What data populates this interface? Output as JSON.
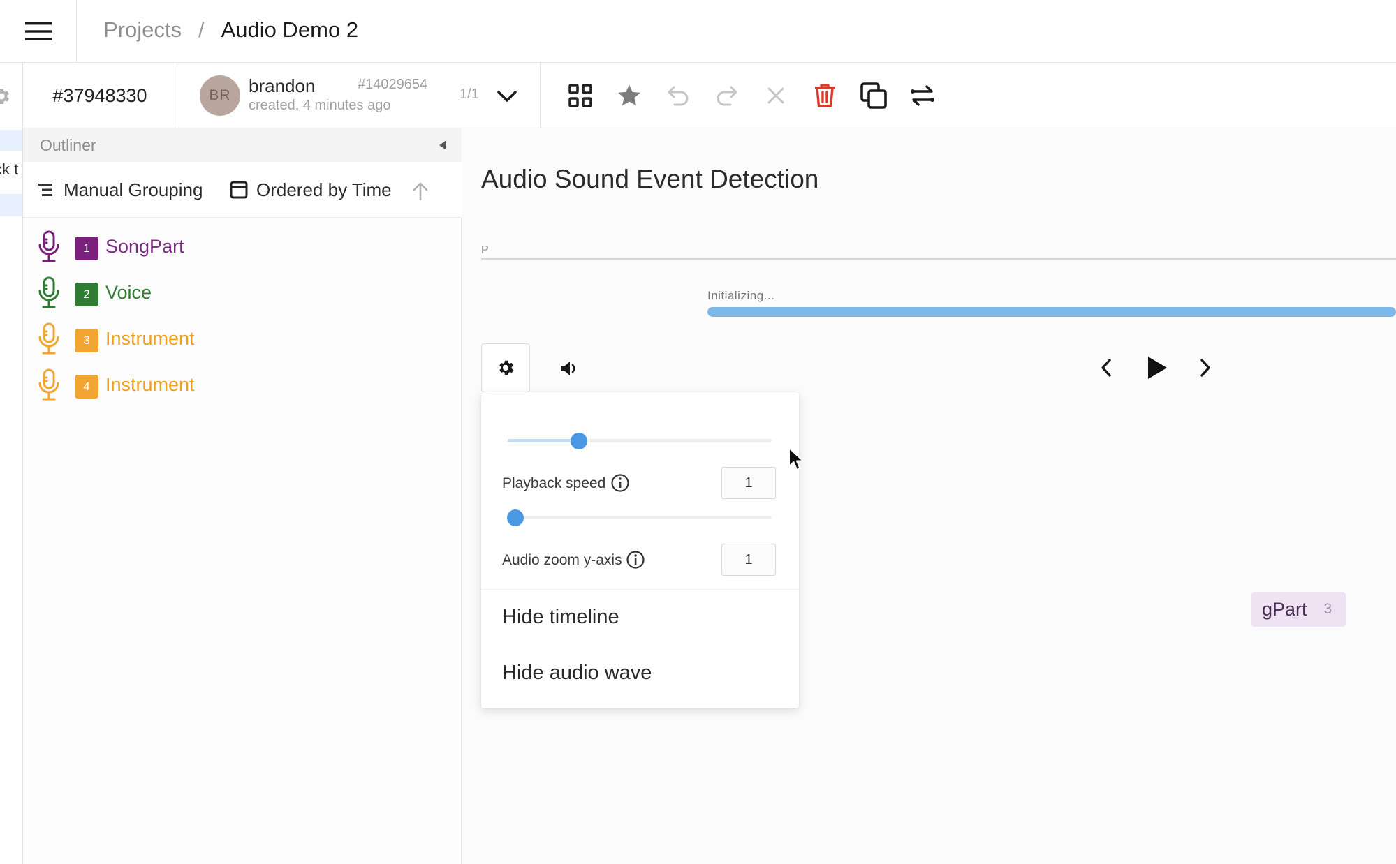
{
  "header": {
    "menu_icon": "hamburger-menu-icon",
    "breadcrumb": {
      "projects": "Projects",
      "separator": "/",
      "current": "Audio Demo 2"
    }
  },
  "toolbar": {
    "task_id": "#37948330",
    "annotation": {
      "avatar_initials": "BR",
      "user": "brandon",
      "created": "created, 4 minutes ago",
      "id": "#14029654",
      "count": "1/1"
    },
    "tools": [
      {
        "name": "grid-view-icon"
      },
      {
        "name": "star-icon"
      },
      {
        "name": "undo-icon"
      },
      {
        "name": "redo-icon"
      },
      {
        "name": "close-icon"
      },
      {
        "name": "trash-icon",
        "color": "#d93a2b"
      },
      {
        "name": "duplicate-icon"
      },
      {
        "name": "swap-icon"
      }
    ]
  },
  "left_rail": {
    "partial_text": "ck t"
  },
  "outliner": {
    "title": "Outliner",
    "grouping": "Manual Grouping",
    "ordering": "Ordered by Time",
    "regions": [
      {
        "index": "1",
        "label": "SongPart",
        "color": "#7b1f7c",
        "text_color": "#7b2c80"
      },
      {
        "index": "2",
        "label": "Voice",
        "color": "#2f7d32",
        "text_color": "#2f7d32"
      },
      {
        "index": "3",
        "label": "Instrument",
        "color": "#f2a531",
        "text_color": "#f0a020"
      },
      {
        "index": "4",
        "label": "Instrument",
        "color": "#f2a531",
        "text_color": "#f0a020"
      }
    ]
  },
  "main": {
    "title": "Audio Sound Event Detection",
    "timeline_marker": "P",
    "status": "Initializing...",
    "progress": 1.0,
    "region_chip": {
      "label": "gPart",
      "count": "3"
    }
  },
  "settings_popover": {
    "volume_level": 0.27,
    "playback_speed": {
      "label": "Playback speed",
      "value": "1",
      "slider_level": 0.03
    },
    "audio_zoom": {
      "label": "Audio zoom y-axis",
      "value": "1"
    },
    "hide_timeline": "Hide timeline",
    "hide_audio_wave": "Hide audio wave"
  },
  "colors": {
    "accent": "#4a98e3",
    "progress": "#7db8ea",
    "danger": "#d93a2b"
  }
}
